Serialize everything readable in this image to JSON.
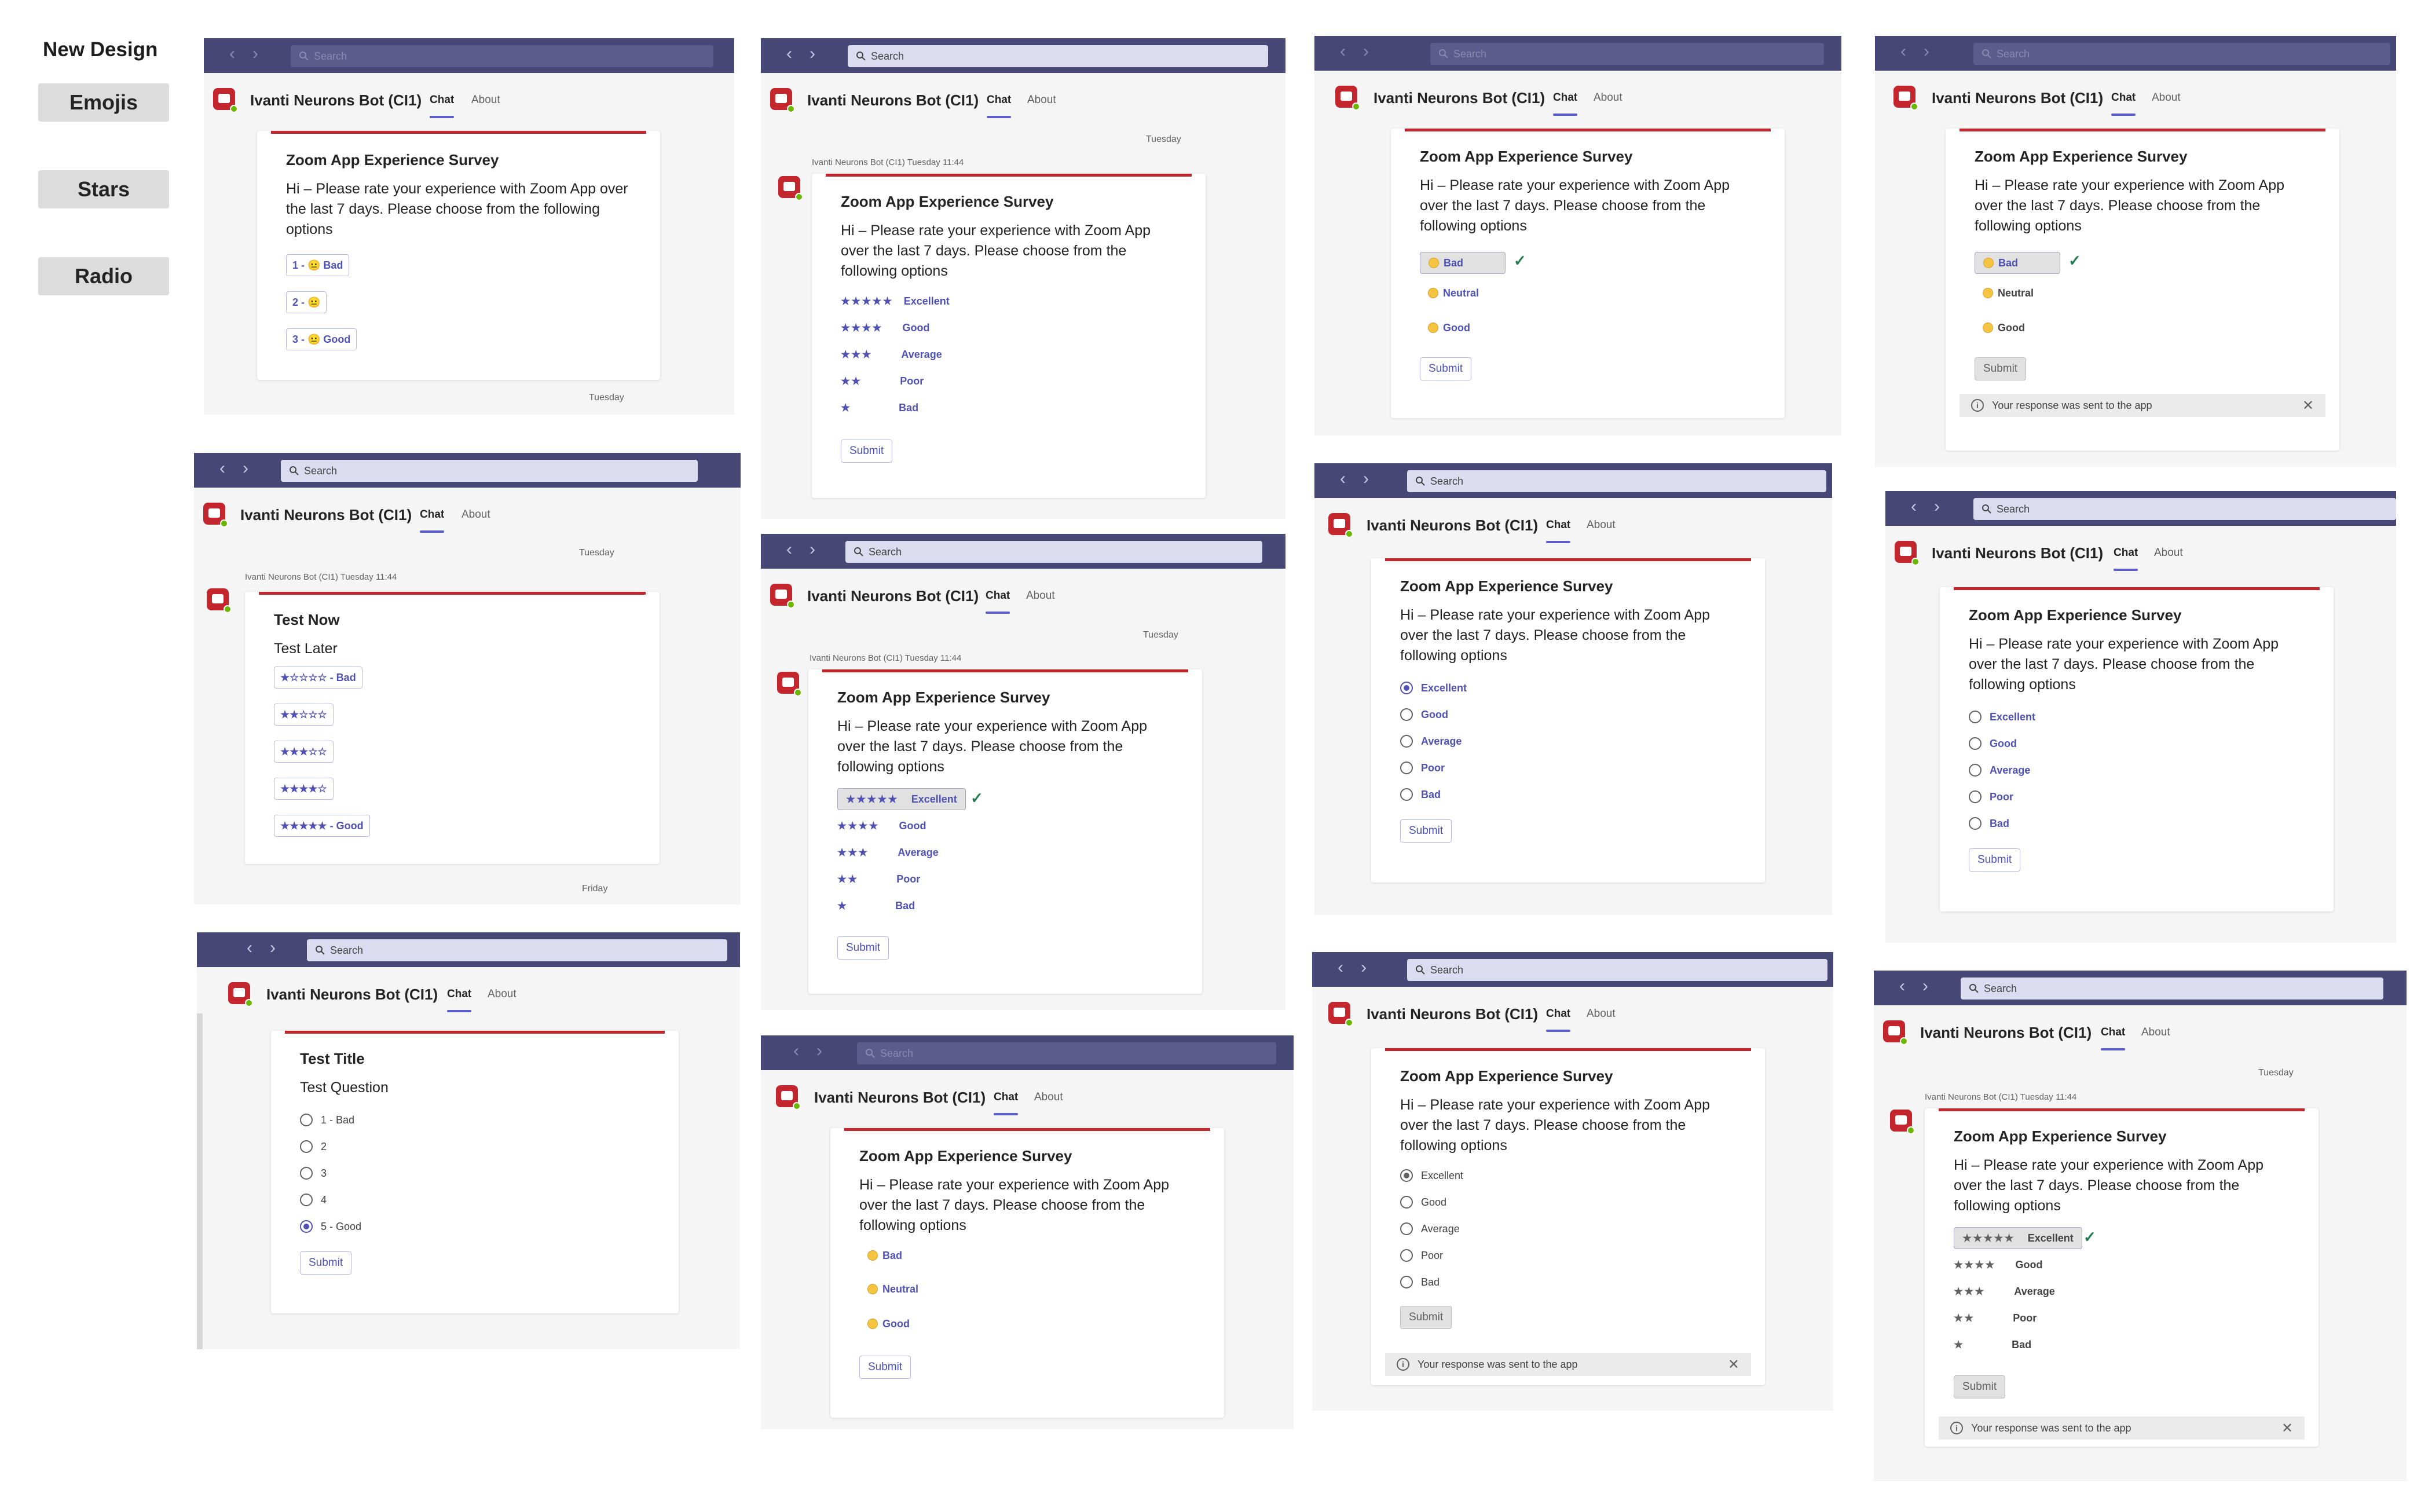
{
  "sidebar": {
    "title": "New Design",
    "buttons": [
      "Emojis",
      "Stars",
      "Radio"
    ]
  },
  "app": {
    "search_placeholder": "Search",
    "bot_name": "Ivanti Neurons Bot (CI1)",
    "tab_chat": "Chat",
    "tab_about": "About",
    "day_tuesday": "Tuesday",
    "day_friday": "Friday",
    "sender_line": "Ivanti Neurons Bot (CI1)  Tuesday 11:44"
  },
  "survey": {
    "title": "Zoom App Experience Survey",
    "body": "Hi – Please rate your experience with Zoom App over the last 7 days. Please choose from the following options",
    "submit": "Submit",
    "sent_notice": "Your response was sent to the app"
  },
  "emoji_buttons_v1": [
    "1 - 😐 Bad",
    "2 - 😐",
    "3 - 😐 Good"
  ],
  "emoji_options": [
    "Bad",
    "Neutral",
    "Good"
  ],
  "star_options": [
    {
      "stars": "★★★★★",
      "label": "Excellent"
    },
    {
      "stars": "★★★★",
      "label": "Good"
    },
    {
      "stars": "★★★",
      "label": "Average"
    },
    {
      "stars": "★★",
      "label": "Poor"
    },
    {
      "stars": "★",
      "label": "Bad"
    }
  ],
  "radio_options": [
    "Excellent",
    "Good",
    "Average",
    "Poor",
    "Bad"
  ],
  "test_stars": {
    "title": "Test Now",
    "subtitle": "Test Later",
    "buttons": [
      "★☆☆☆☆ - Bad",
      "★★☆☆☆",
      "★★★☆☆",
      "★★★★☆",
      "★★★★★ - Good"
    ]
  },
  "test_radio": {
    "title": "Test Title",
    "subtitle": "Test Question",
    "options": [
      "1 - Bad",
      "2",
      "3",
      "4",
      "5 - Good"
    ]
  },
  "colors": {
    "teams_bar": "#464775",
    "accent": "#5b5fc7",
    "card_top": "#c4262e",
    "check": "#237b4b"
  }
}
